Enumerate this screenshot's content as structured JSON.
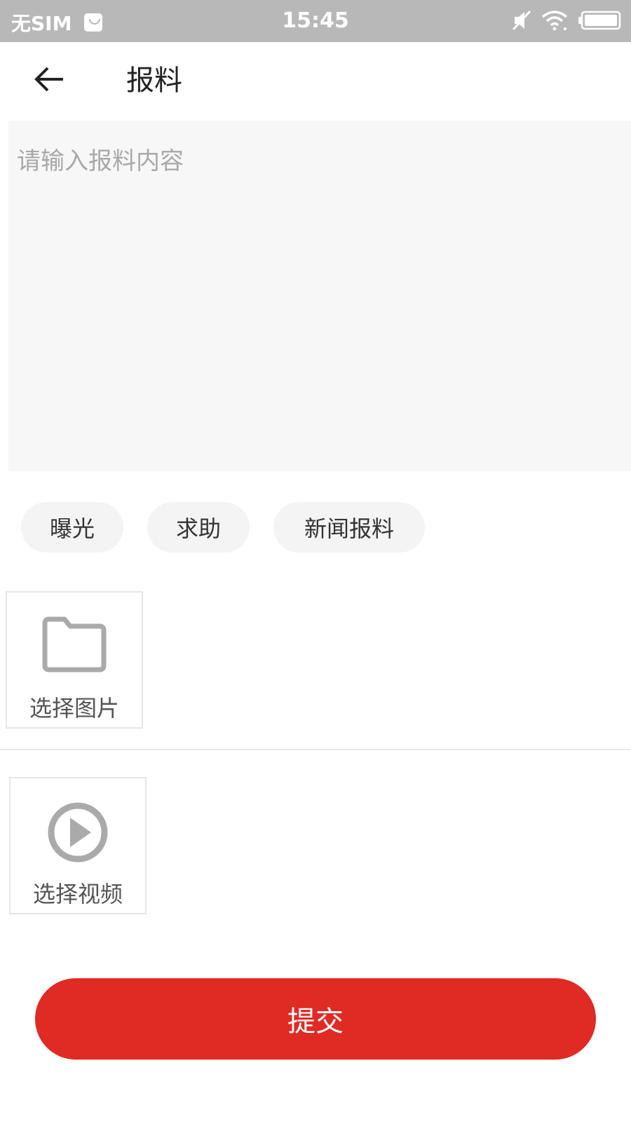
{
  "status_bar": {
    "carrier": "无SIM",
    "time": "15:45",
    "icons": [
      "message-icon",
      "mute-icon",
      "wifi-icon",
      "battery-icon"
    ]
  },
  "toolbar": {
    "title": "报料",
    "back_icon": "arrow-left-icon"
  },
  "content": {
    "placeholder": "请输入报料内容",
    "value": ""
  },
  "tags": [
    {
      "label": "曝光"
    },
    {
      "label": "求助"
    },
    {
      "label": "新闻报料"
    }
  ],
  "pickers": {
    "image": {
      "label": "选择图片",
      "icon": "folder-icon"
    },
    "video": {
      "label": "选择视频",
      "icon": "play-circle-icon"
    }
  },
  "submit": {
    "label": "提交"
  },
  "colors": {
    "accent": "#e02a24",
    "status_bar_bg": "#b8b8b8",
    "input_bg": "#f7f7f7",
    "tag_bg": "#f4f4f4",
    "icon_gray": "#aaaaaa"
  }
}
